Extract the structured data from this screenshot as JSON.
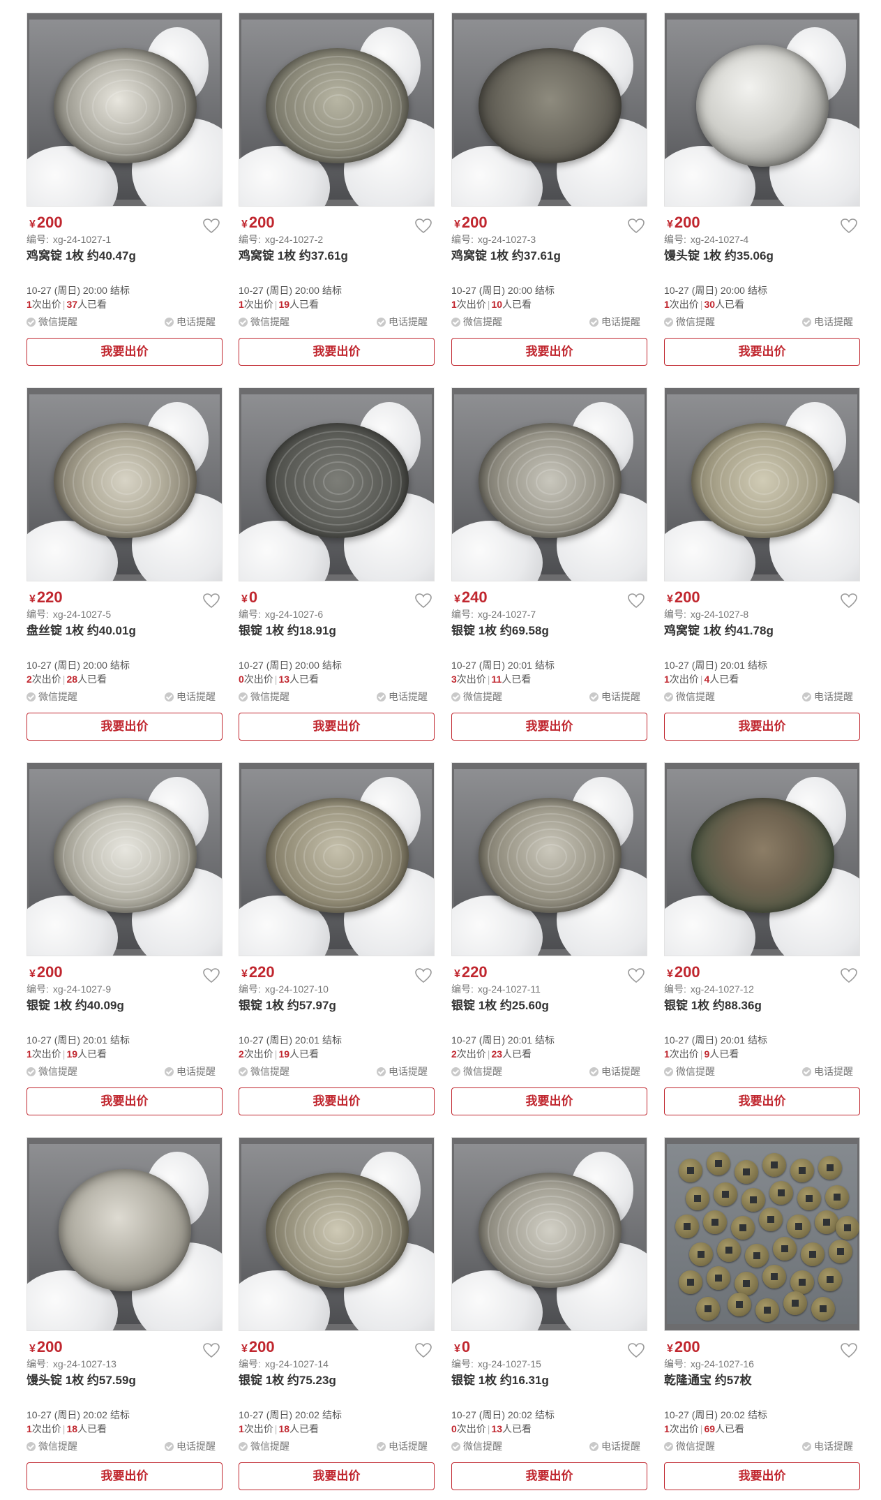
{
  "labels": {
    "currency": "¥",
    "code_prefix": "编号:",
    "deadline_suffix": "结标",
    "bids_suffix": "次出价",
    "views_suffix": "人已看",
    "wechat_remind": "微信提醒",
    "phone_remind": "电话提醒",
    "bid_button": "我要出价",
    "separator": "|"
  },
  "colors": {
    "accent": "#c0262e",
    "muted": "#777777",
    "border": "#e3e3e3"
  },
  "items": [
    {
      "price": "200",
      "code": "xg-24-1027-1",
      "name": "鸡窝锭 1枚 约40.47g",
      "deadline": "10-27 (周日) 20:00",
      "bids": "1",
      "views": "37",
      "photo_icon": "silver-ingot-spiral"
    },
    {
      "price": "200",
      "code": "xg-24-1027-2",
      "name": "鸡窝锭 1枚 约37.61g",
      "deadline": "10-27 (周日) 20:00",
      "bids": "1",
      "views": "19",
      "photo_icon": "silver-ingot"
    },
    {
      "price": "200",
      "code": "xg-24-1027-3",
      "name": "鸡窝锭 1枚 约37.61g",
      "deadline": "10-27 (周日) 20:00",
      "bids": "1",
      "views": "10",
      "photo_icon": "silver-ingot"
    },
    {
      "price": "200",
      "code": "xg-24-1027-4",
      "name": "馒头锭 1枚 约35.06g",
      "deadline": "10-27 (周日) 20:00",
      "bids": "1",
      "views": "30",
      "photo_icon": "silver-ingot-dome"
    },
    {
      "price": "220",
      "code": "xg-24-1027-5",
      "name": "盘丝锭 1枚 约40.01g",
      "deadline": "10-27 (周日) 20:00",
      "bids": "2",
      "views": "28",
      "photo_icon": "silver-ingot-rings"
    },
    {
      "price": "0",
      "code": "xg-24-1027-6",
      "name": "银锭 1枚 约18.91g",
      "deadline": "10-27 (周日) 20:00",
      "bids": "0",
      "views": "13",
      "photo_icon": "silver-ingot-dark"
    },
    {
      "price": "240",
      "code": "xg-24-1027-7",
      "name": "银锭 1枚 约69.58g",
      "deadline": "10-27 (周日) 20:01",
      "bids": "3",
      "views": "11",
      "photo_icon": "silver-ingot"
    },
    {
      "price": "200",
      "code": "xg-24-1027-8",
      "name": "鸡窝锭 1枚 约41.78g",
      "deadline": "10-27 (周日) 20:01",
      "bids": "1",
      "views": "4",
      "photo_icon": "silver-ingot-rings"
    },
    {
      "price": "200",
      "code": "xg-24-1027-9",
      "name": "银锭 1枚 约40.09g",
      "deadline": "10-27 (周日) 20:01",
      "bids": "1",
      "views": "19",
      "photo_icon": "silver-ingot-rings"
    },
    {
      "price": "220",
      "code": "xg-24-1027-10",
      "name": "银锭 1枚 约57.97g",
      "deadline": "10-27 (周日) 20:01",
      "bids": "2",
      "views": "19",
      "photo_icon": "silver-ingot-rings"
    },
    {
      "price": "220",
      "code": "xg-24-1027-11",
      "name": "银锭 1枚 约25.60g",
      "deadline": "10-27 (周日) 20:01",
      "bids": "2",
      "views": "23",
      "photo_icon": "silver-ingot-rings"
    },
    {
      "price": "200",
      "code": "xg-24-1027-12",
      "name": "银锭 1枚 约88.36g",
      "deadline": "10-27 (周日) 20:01",
      "bids": "1",
      "views": "9",
      "photo_icon": "silver-ingot-patina"
    },
    {
      "price": "200",
      "code": "xg-24-1027-13",
      "name": "馒头锭 1枚 约57.59g",
      "deadline": "10-27 (周日) 20:02",
      "bids": "1",
      "views": "18",
      "photo_icon": "silver-ingot-dome"
    },
    {
      "price": "200",
      "code": "xg-24-1027-14",
      "name": "银锭 1枚 约75.23g",
      "deadline": "10-27 (周日) 20:02",
      "bids": "1",
      "views": "18",
      "photo_icon": "silver-ingot-rings"
    },
    {
      "price": "0",
      "code": "xg-24-1027-15",
      "name": "银锭 1枚 约16.31g",
      "deadline": "10-27 (周日) 20:02",
      "bids": "0",
      "views": "13",
      "photo_icon": "silver-ingot-rings"
    },
    {
      "price": "200",
      "code": "xg-24-1027-16",
      "name": "乾隆通宝 约57枚",
      "deadline": "10-27 (周日) 20:02",
      "bids": "1",
      "views": "69",
      "photo_icon": "copper-cash-coins"
    }
  ]
}
